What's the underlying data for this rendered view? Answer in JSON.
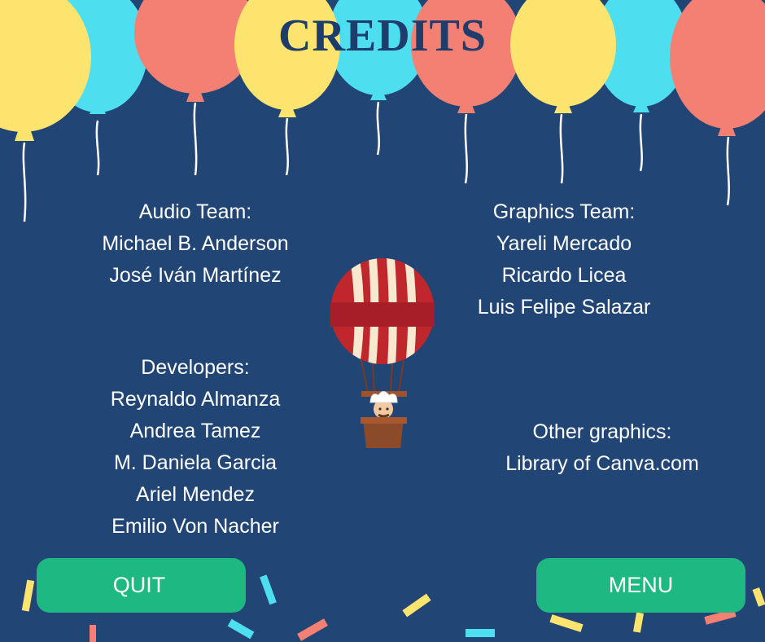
{
  "title": "CREDITS",
  "audio_team": {
    "heading": "Audio Team:",
    "members": [
      "Michael B. Anderson",
      "José Iván Martínez"
    ]
  },
  "graphics_team": {
    "heading": "Graphics Team:",
    "members": [
      "Yareli Mercado",
      "Ricardo Licea",
      "Luis Felipe Salazar"
    ]
  },
  "developers": {
    "heading": "Developers:",
    "members": [
      "Reynaldo Almanza",
      "Andrea Tamez",
      "M. Daniela Garcia",
      "Ariel Mendez",
      "Emilio Von Nacher"
    ]
  },
  "other_graphics": {
    "heading": "Other graphics:",
    "source": "Library of Canva.com"
  },
  "buttons": {
    "quit": "QUIT",
    "menu": "MENU"
  },
  "colors": {
    "background": "#214574",
    "title": "#1f3d6c",
    "button": "#1eb883",
    "balloon_yellow": "#fde46e",
    "balloon_cyan": "#4ddff0",
    "balloon_coral": "#f47f73",
    "hot_air_balloon_red": "#c0272d",
    "hot_air_balloon_cream": "#f7e8d0"
  },
  "icons": [
    "party-balloon-icon",
    "hot-air-balloon-icon",
    "chef-character-icon",
    "confetti-icon"
  ]
}
